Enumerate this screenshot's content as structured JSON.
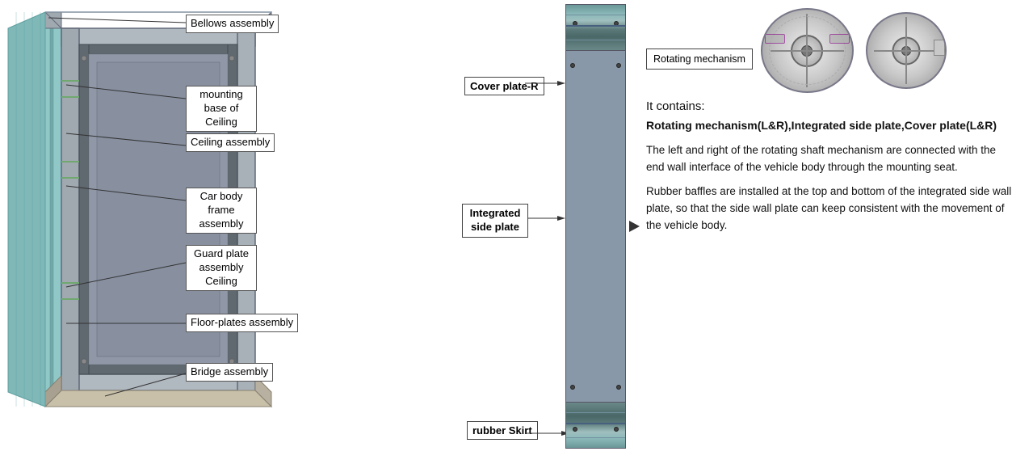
{
  "diagram": {
    "labels": {
      "bellows": "Bellows assembly",
      "mounting_base": "mounting base of Ceiling",
      "ceiling_assembly": "Ceiling assembly",
      "car_body_frame": "Car body frame assembly",
      "guard_plate": "Guard plate assembly Ceiling",
      "floor_plates": "Floor-plates assembly",
      "bridge": "Bridge assembly",
      "cover_plate_r": "Cover plate-R",
      "integrated_side_plate": "Integrated side plate",
      "rubber_skirt": "rubber Skirt",
      "rotating_mechanism": "Rotating mechanism"
    }
  },
  "right_section": {
    "it_contains_label": "It contains:",
    "description_bold": "Rotating mechanism(L&R),Integrated side plate,Cover plate(L&R)",
    "paragraph1": "The left and right of the rotating shaft mechanism are connected with the end wall interface of the vehicle body through the mounting seat.",
    "paragraph2": "Rubber baffles are installed at the top and bottom of the integrated side  wall plate, so that the side wall plate can keep consistent with the movement of the vehicle body."
  }
}
